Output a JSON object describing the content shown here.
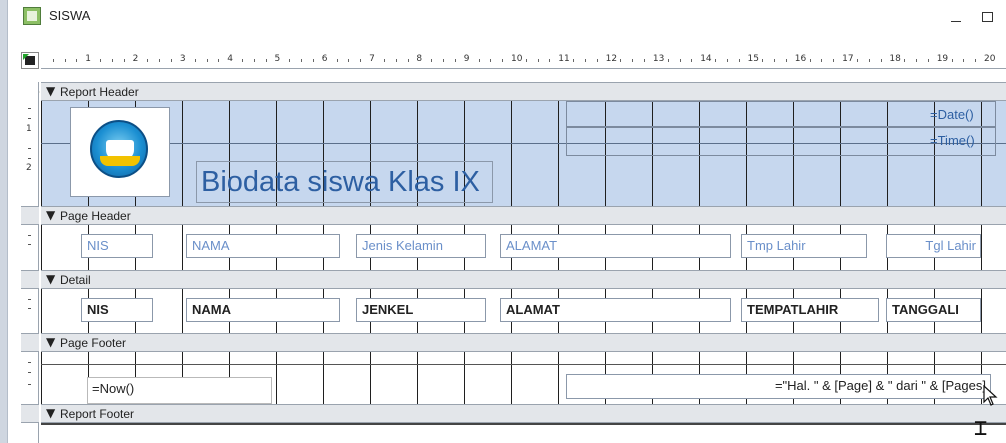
{
  "window": {
    "title": "SISWA",
    "icon": "report-icon"
  },
  "ruler": {
    "numbers": [
      "1",
      "2",
      "3",
      "4",
      "5",
      "6",
      "7",
      "8",
      "9",
      "10",
      "11",
      "12",
      "13",
      "14",
      "15",
      "16",
      "17",
      "18",
      "19",
      "20"
    ],
    "vertical_numbers": [
      "1",
      "2"
    ]
  },
  "sections": {
    "report_header": "Report Header",
    "page_header": "Page Header",
    "detail": "Detail",
    "page_footer": "Page Footer",
    "report_footer": "Report Footer"
  },
  "report_header": {
    "title": "Biodata siswa Klas IX",
    "date_expr": "=Date()",
    "time_expr": "=Time()",
    "logo": "school-emblem"
  },
  "page_header_labels": {
    "nis": "NIS",
    "nama": "NAMA",
    "jenis_kelamin": "Jenis Kelamin",
    "alamat": "ALAMAT",
    "tmp_lahir": "Tmp Lahir",
    "tgl_lahir": "Tgl Lahir"
  },
  "detail_fields": {
    "nis": "NIS",
    "nama": "NAMA",
    "jenkel": "JENKEL",
    "alamat": "ALAMAT",
    "tempatlahir": "TEMPATLAHIR",
    "tanggal": "TANGGALI"
  },
  "page_footer": {
    "now_expr": "=Now()",
    "page_expr": "=\"Hal. \" & [Page] & \" dari \" & [Pages]"
  },
  "colors": {
    "report_header_bg": "#c6d7ee",
    "label_text": "#6a8fc9",
    "title_text": "#2d5fa2"
  }
}
